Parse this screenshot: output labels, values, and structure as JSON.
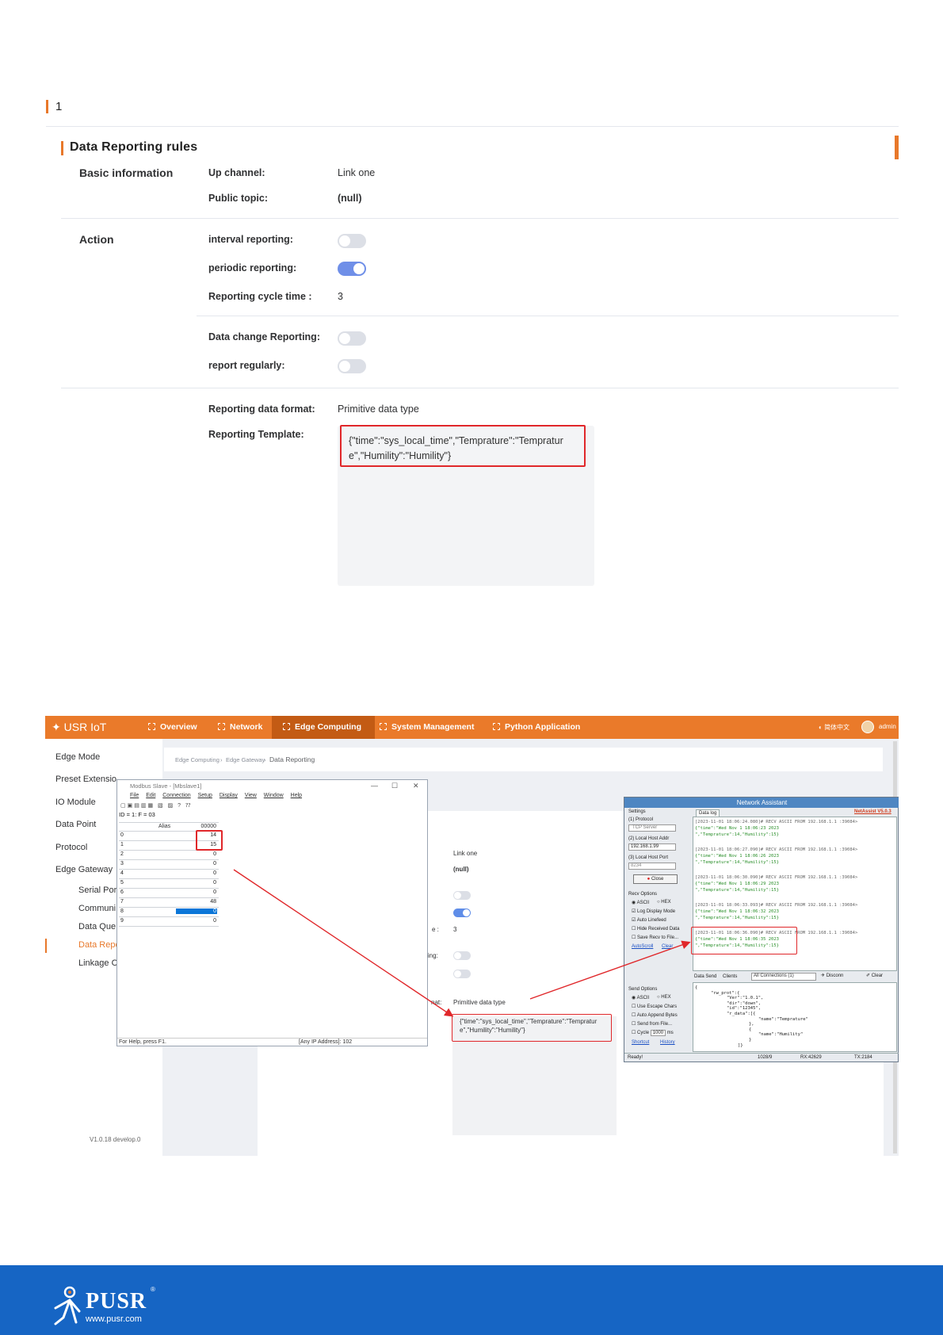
{
  "section": {
    "number": "1"
  },
  "rules": {
    "title": "Data Reporting rules",
    "basic_heading": "Basic information",
    "up_channel_label": "Up channel:",
    "up_channel_value": "Link one",
    "public_topic_label": "Public topic:",
    "public_topic_value": "(null)",
    "action_heading": "Action",
    "interval_label": "interval reporting:",
    "interval_on": false,
    "periodic_label": "periodic reporting:",
    "periodic_on": true,
    "cycle_label": "Reporting cycle time :",
    "cycle_value": "3",
    "data_change_label": "Data change Reporting:",
    "data_change_on": false,
    "regular_label": "report regularly:",
    "regular_on": false,
    "format_label": "Reporting data format:",
    "format_value": "Primitive data type",
    "template_label": "Reporting Template:",
    "template_value": "{\"time\":\"sys_local_time\",\"Temprature\":\"Temprature\",\"Humility\":\"Humility\"}"
  },
  "screenshot": {
    "nav": {
      "logo": "USR IoT",
      "items": [
        "Overview",
        "Network",
        "Edge Computing",
        "System Management",
        "Python Application"
      ],
      "lang": "简体中文",
      "user": "admin"
    },
    "sidebar": {
      "items": [
        "Edge Mode",
        "Preset Extensio",
        "IO Module",
        "Data Point",
        "Protocol",
        "Edge Gateway"
      ],
      "sub_items": [
        "Serial Por",
        "Communi",
        "Data Que",
        "Data Repo",
        "Linkage C"
      ],
      "version": "V1.0.18 develop.0"
    },
    "breadcrumb": [
      "Edge Computing",
      "Edge Gateway",
      "Data Reporting"
    ],
    "mini": {
      "up_channel_value": "Link one",
      "public_topic_value": "(null)",
      "cycle_partial": "e :",
      "cycle_value": "3",
      "data_change_partial": "rting:",
      "format_partial": "nat:",
      "format_value": "Primitive data type",
      "template_value": "{\"time\":\"sys_local_time\",\"Temprature\":\"Temprature\",\"Humility\":\"Humility\"}"
    },
    "modbus": {
      "title": "Modbus Slave - [Mbslave1]",
      "menu": [
        "File",
        "Edit",
        "Connection",
        "Setup",
        "Display",
        "View",
        "Window",
        "Help"
      ],
      "id_line": "ID = 1: F = 03",
      "col_alias": "Alias",
      "col_addr": "00000",
      "rows": [
        "14",
        "15",
        "0",
        "0",
        "0",
        "0",
        "0",
        "48",
        "0",
        "0"
      ],
      "status_left": "For Help, press F1.",
      "status_right": "[Any IP Address]: 102"
    },
    "netassist": {
      "title": "Network Assistant",
      "version": "NetAssist V5.0.3",
      "settings": "Settings",
      "protocol_label": "(1) Protocol",
      "protocol_value": "TCP Server",
      "host_label": "(2) Local Host Addr",
      "host_value": "192.168.1.99",
      "port_label": "(3) Local Host Port",
      "port_value": "8234",
      "close_btn": "Close",
      "recv_options": "Recv Options",
      "ascii": "ASCII",
      "hex": "HEX",
      "log_display": "Log Display Mode",
      "auto_linefeed": "Auto Linefeed",
      "hide_recv": "Hide Received Data",
      "save_recv": "Save Recv to File...",
      "auto_scroll": "AutoScroll",
      "clear": "Clear",
      "send_options": "Send Options",
      "use_escape": "Use Escape Chars",
      "auto_append": "Auto Append Bytes",
      "send_file": "Send from File...",
      "cycle": "Cycle",
      "cycle_ms": "1000",
      "ms": "ms",
      "shortcut": "Shortcut",
      "history": "History",
      "data_log_tab": "Data log",
      "data_send_tab": "Data Send",
      "clients_tab": "Clients",
      "all_conn": "All Connections (1)",
      "disconn": "Disconn",
      "clear_btn": "Clear",
      "log": [
        "[2023-11-01 18:06:24.080]# RECV ASCII FROM 192.168.1.1 :39084>",
        "{\"time\":\"Wed Nov  1 18:06:23 2023",
        "\",\"Temprature\":14,\"Humility\":15}",
        "[2023-11-01 18:06:27.090]# RECV ASCII FROM 192.168.1.1 :39084>",
        "{\"time\":\"Wed Nov  1 18:06:26 2023",
        "\",\"Temprature\":14,\"Humility\":15}",
        "[2023-11-01 18:06:30.090]# RECV ASCII FROM 192.168.1.1 :39084>",
        "{\"time\":\"Wed Nov  1 18:06:29 2023",
        "\",\"Temprature\":14,\"Humility\":15}",
        "[2023-11-01 18:06:33.093]# RECV ASCII FROM 192.168.1.1 :39084>",
        "{\"time\":\"Wed Nov  1 18:06:32 2023",
        "\",\"Temprature\":14,\"Humility\":15}",
        "[2023-11-01 18:06:36.090]# RECV ASCII FROM 192.168.1.1 :39084>",
        "{\"time\":\"Wed Nov  1 18:06:35 2023",
        "\",\"Temprature\":14,\"Humility\":15}"
      ],
      "send": [
        "{",
        "\"rw_prot\":{",
        "\"Ver\":\"1.0.1\",",
        "\"dir\":\"down\",",
        "\"id\":\"12345\",",
        "\"r_data\":[{",
        "\"name\":\"Temprature\"",
        "},",
        "{",
        "\"name\":\"Humility\"",
        "}",
        "]}"
      ],
      "status_ready": "Ready!",
      "status_rx1": "1028/9",
      "status_rx2": "RX:42629",
      "status_tx": "TX:2184"
    }
  },
  "footer": {
    "logo": "PUSR",
    "reg": "®",
    "url": "www.pusr.com"
  },
  "colors": {
    "accent": "#e8782a",
    "toggle_on": "#6f8fe8",
    "highlight": "#e0272a",
    "footer": "#1665c4"
  }
}
